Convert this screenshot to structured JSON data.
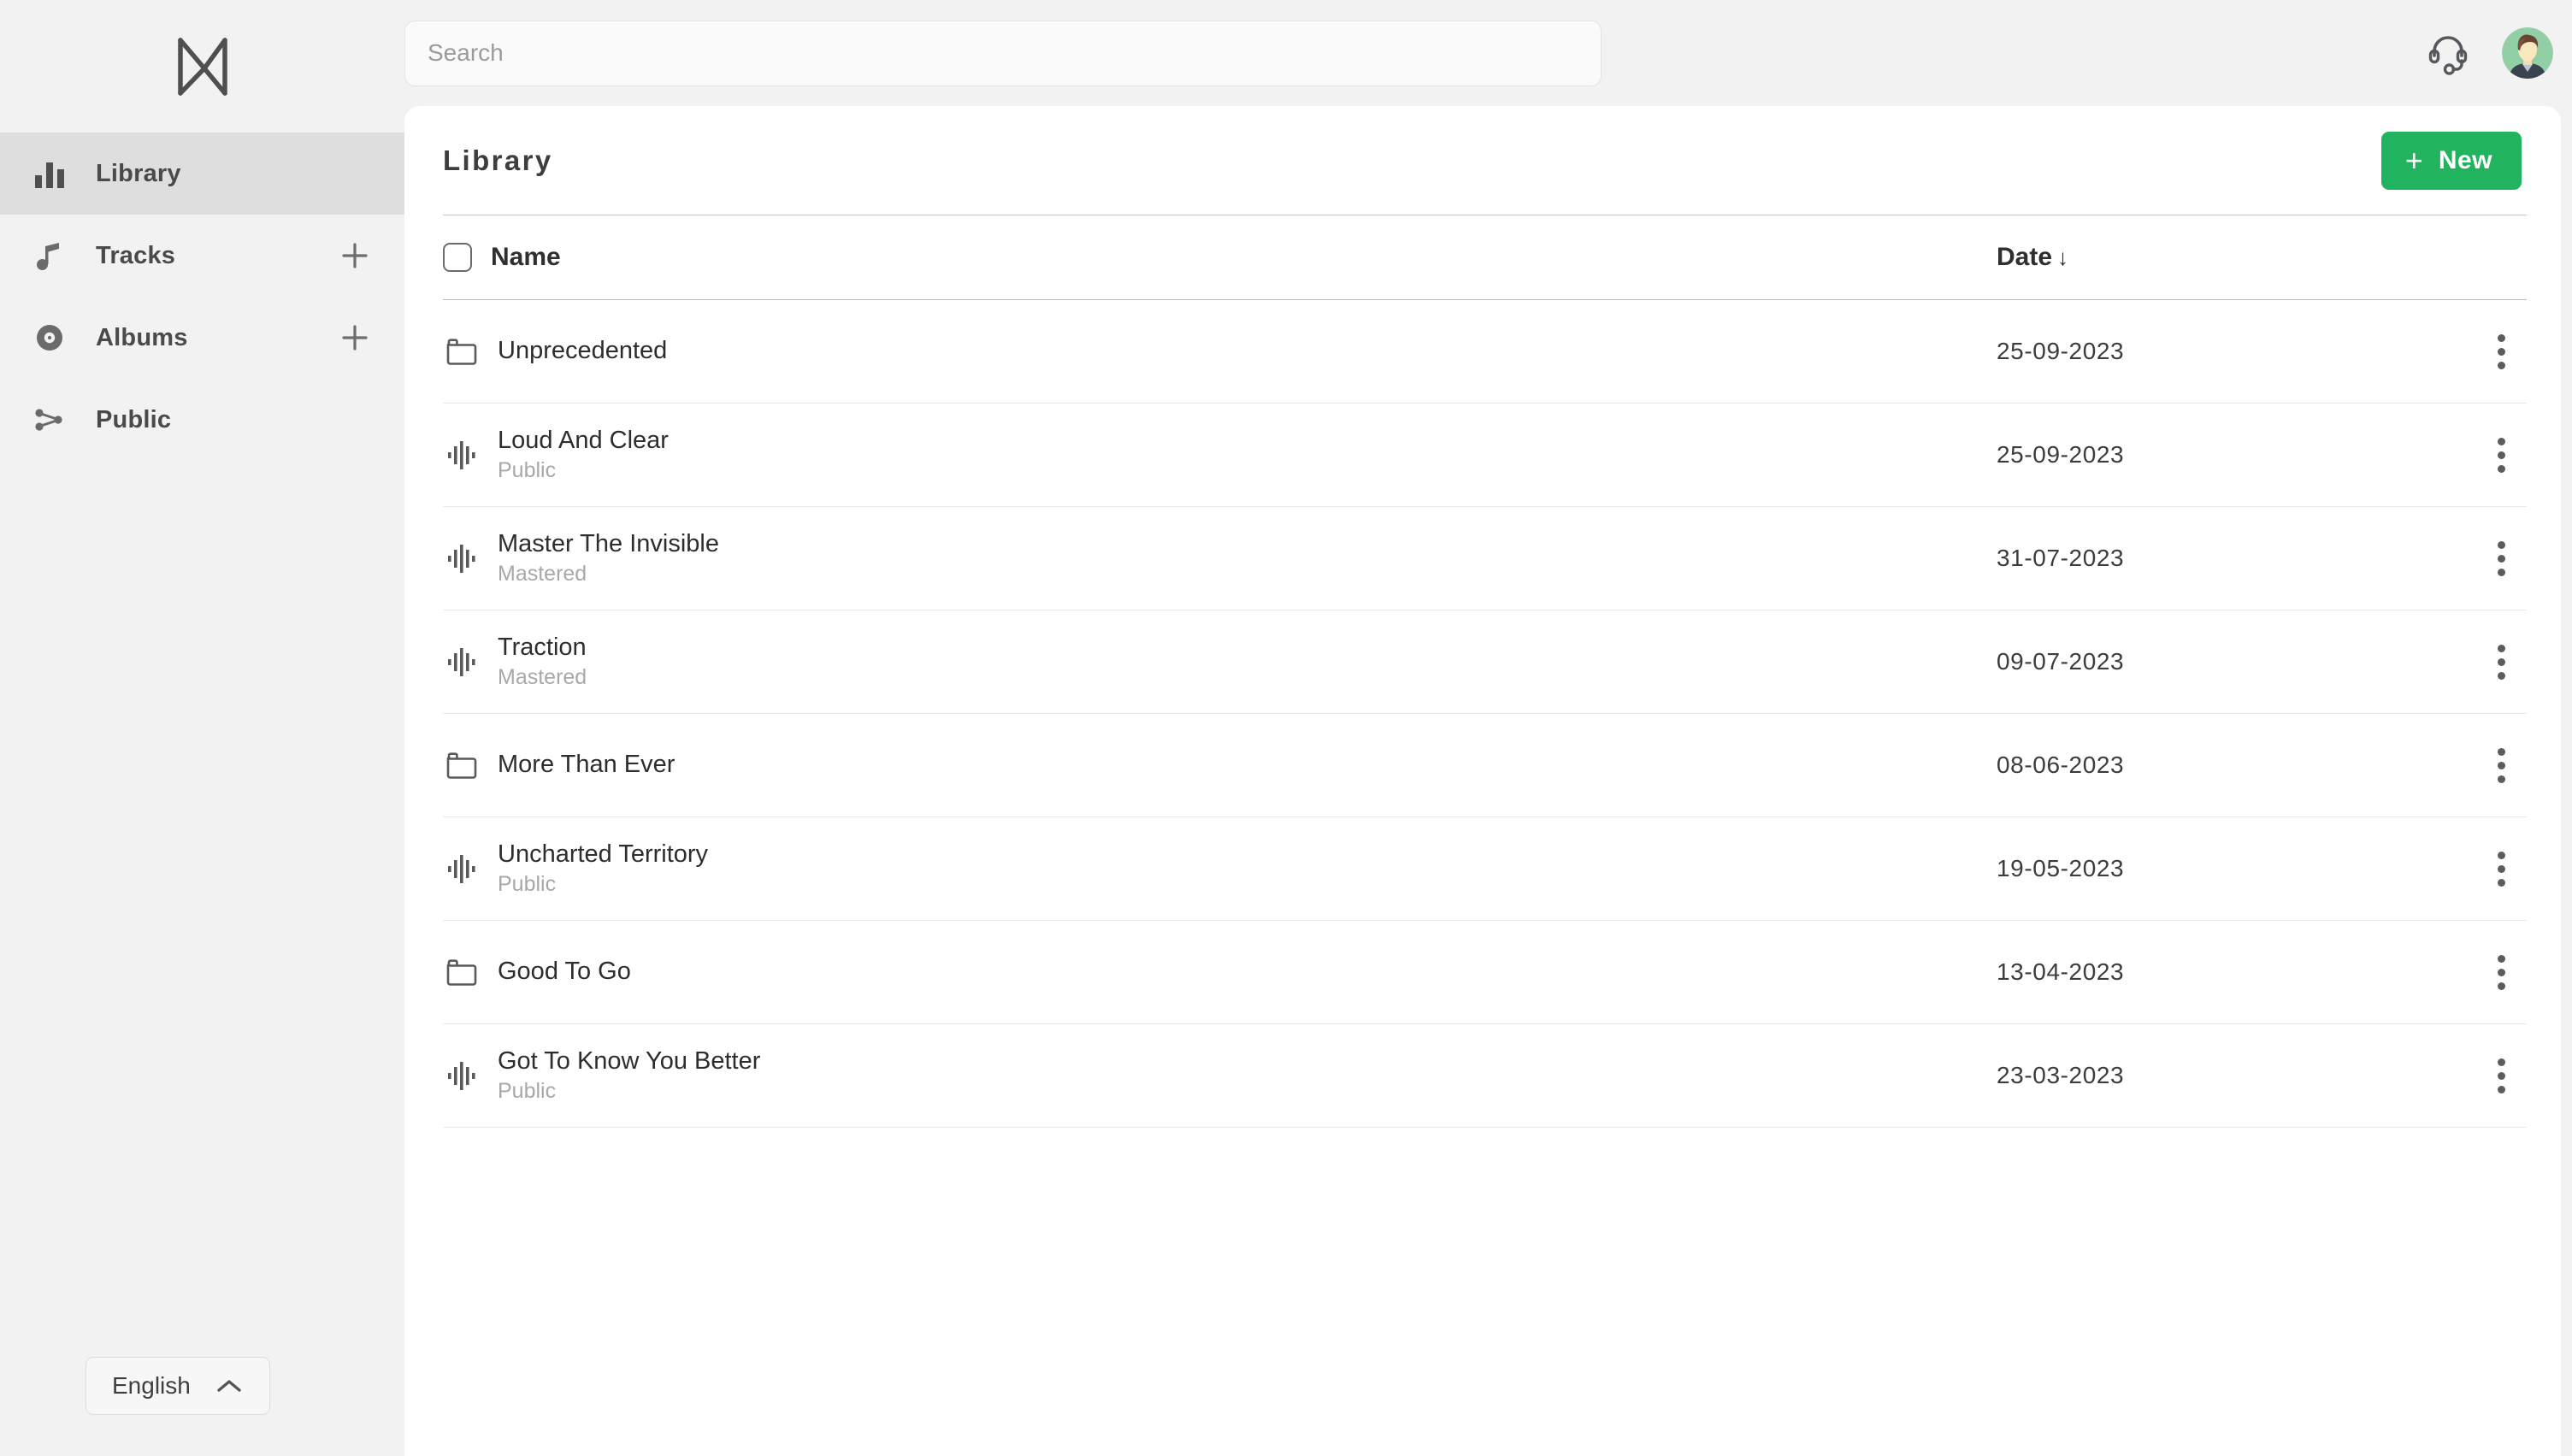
{
  "brand": {
    "logo_icon": "mixea-m-logo"
  },
  "search": {
    "placeholder": "Search",
    "value": ""
  },
  "topbar": {
    "support_icon": "headset-icon",
    "avatar_icon": "user-avatar"
  },
  "sidebar": {
    "items": [
      {
        "label": "Library",
        "icon": "bar-chart-icon",
        "active": true,
        "has_add": false
      },
      {
        "label": "Tracks",
        "icon": "music-note-icon",
        "active": false,
        "has_add": true
      },
      {
        "label": "Albums",
        "icon": "vinyl-record-icon",
        "active": false,
        "has_add": true
      },
      {
        "label": "Public",
        "icon": "share-icon",
        "active": false,
        "has_add": false
      }
    ],
    "language": {
      "label": "English",
      "chevron_icon": "chevron-up-icon"
    }
  },
  "panel": {
    "title": "Library",
    "new_button": {
      "label": "New",
      "plus": "+",
      "color": "#21b35d"
    }
  },
  "table": {
    "columns": {
      "name": "Name",
      "date": "Date",
      "sort_arrow": "↓"
    },
    "rows": [
      {
        "name": "Unprecedented",
        "status": "",
        "date": "25-09-2023",
        "icon": "folder-icon"
      },
      {
        "name": "Loud And Clear",
        "status": "Public",
        "date": "25-09-2023",
        "icon": "waveform-icon"
      },
      {
        "name": "Master The Invisible",
        "status": "Mastered",
        "date": "31-07-2023",
        "icon": "waveform-icon"
      },
      {
        "name": "Traction",
        "status": "Mastered",
        "date": "09-07-2023",
        "icon": "waveform-icon"
      },
      {
        "name": "More Than Ever",
        "status": "",
        "date": "08-06-2023",
        "icon": "folder-icon"
      },
      {
        "name": "Uncharted Territory",
        "status": "Public",
        "date": "19-05-2023",
        "icon": "waveform-icon"
      },
      {
        "name": "Good To Go",
        "status": "",
        "date": "13-04-2023",
        "icon": "folder-icon"
      },
      {
        "name": "Got To Know You Better",
        "status": "Public",
        "date": "23-03-2023",
        "icon": "waveform-icon"
      }
    ]
  }
}
